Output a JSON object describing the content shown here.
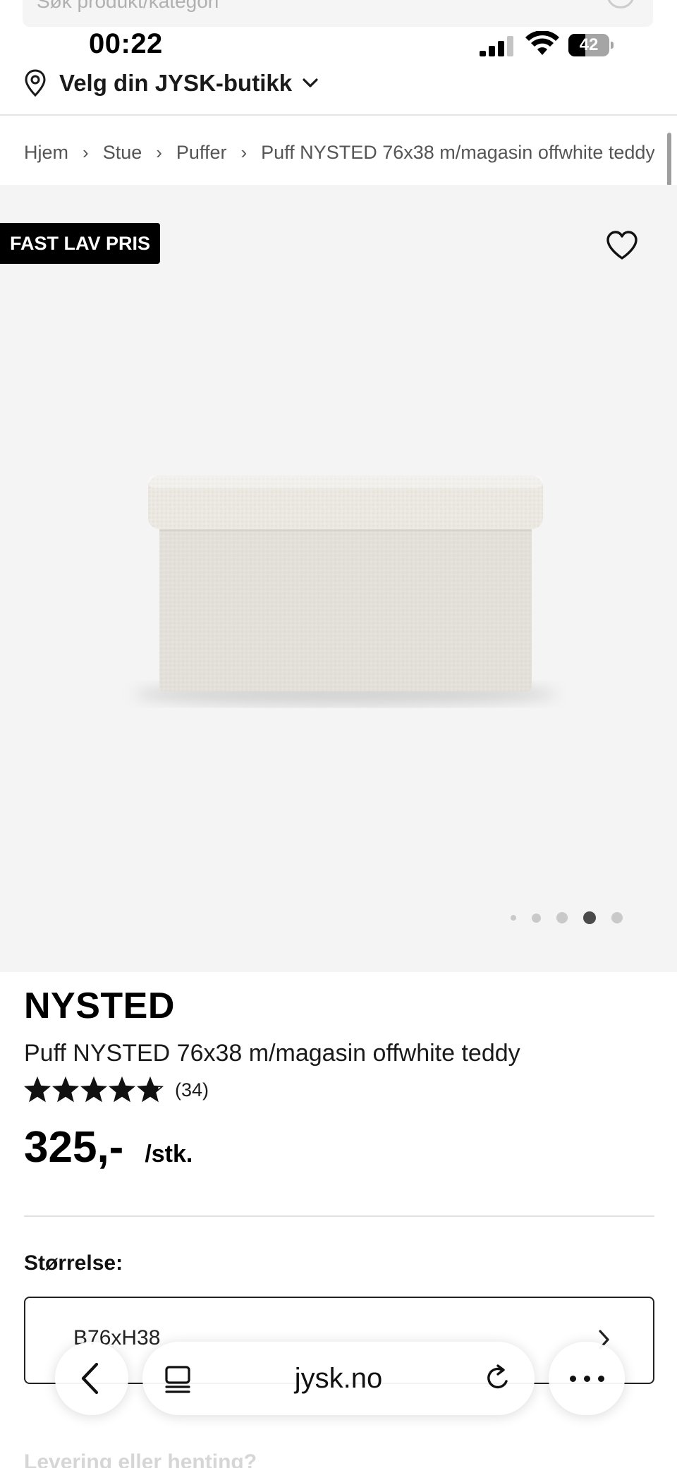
{
  "status_bar": {
    "time": "00:22",
    "battery_level": "42",
    "signal_bars": 3,
    "signal_bars_total": 4
  },
  "header": {
    "search_placeholder": "Søk produkt/kategori",
    "store_selector_label": "Velg din JYSK-butikk"
  },
  "breadcrumb": {
    "items": [
      "Hjem",
      "Stue",
      "Puffer",
      "Puff NYSTED 76x38 m/magasin offwhite teddy"
    ],
    "separator": "›"
  },
  "gallery": {
    "badge": "FAST LAV PRIS",
    "image_count": 5,
    "active_index": 3,
    "favourite_icon": "heart-outline-icon"
  },
  "product": {
    "brand": "NYSTED",
    "name": "Puff NYSTED 76x38 m/magasin offwhite teddy",
    "rating_value": 4.8,
    "rating_max": 5,
    "review_count": "(34)",
    "price": "325,-",
    "unit": "/stk."
  },
  "size": {
    "label": "Størrelse:",
    "selected": "B76xH38"
  },
  "delivery": {
    "heading": "Levering eller henting?"
  },
  "browser": {
    "url": "jysk.no"
  },
  "colors": {
    "page_background": "#ffffff",
    "gallery_background": "#f4f4f4",
    "badge_background": "#000000",
    "badge_text": "#ffffff",
    "product_fabric": "#ece9e3"
  }
}
